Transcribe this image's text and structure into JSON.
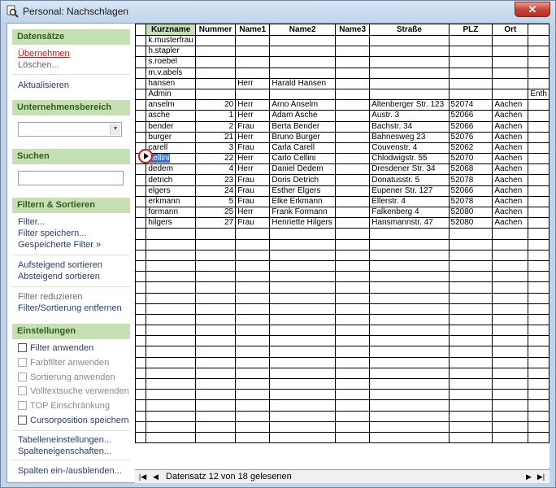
{
  "window": {
    "title": "Personal: Nachschlagen",
    "close_icon": "close-icon"
  },
  "sidebar": {
    "datensaetze": {
      "header": "Datensätze",
      "uebernehmen": "Übernehmen",
      "loeschen": "Löschen...",
      "aktualisieren": "Aktualisieren"
    },
    "unternehmensbereich": {
      "header": "Unternehmensbereich",
      "value": ""
    },
    "suchen": {
      "header": "Suchen",
      "value": ""
    },
    "filtern": {
      "header": "Filtern & Sortieren",
      "filter": "Filter...",
      "filter_speichern": "Filter speichern...",
      "gespeicherte_filter": "Gespeicherte Filter »",
      "aufsteigend": "Aufsteigend sortieren",
      "absteigend": "Absteigend sortieren",
      "reduzieren": "Filter reduzieren",
      "entfernen": "Filter/Sortierung entfernen"
    },
    "einstellungen": {
      "header": "Einstellungen",
      "filter_anwenden": "Filter anwenden",
      "farbfilter": "Farbfilter anwenden",
      "sortierung": "Sortierung anwenden",
      "volltextsuche": "Volltextsuche verwenden",
      "top": "TOP Einschränkung",
      "cursorposition": "Cursorposition speichern",
      "tabelleneinstellungen": "Tabelleneinstellungen...",
      "spalteneigenschaften": "Spalteneigenschaften...",
      "spalten_einaus": "Spalten ein-/ausblenden..."
    }
  },
  "table": {
    "columns": [
      "Kurzname",
      "Nummer",
      "Name1",
      "Name2",
      "Name3",
      "Straße",
      "PLZ",
      "Ort",
      ""
    ],
    "rows": [
      [
        "k.musterfrau",
        "",
        "",
        "",
        "",
        "",
        "",
        "",
        ""
      ],
      [
        "h.stapler",
        "",
        "",
        "",
        "",
        "",
        "",
        "",
        ""
      ],
      [
        "s.roebel",
        "",
        "",
        "",
        "",
        "",
        "",
        "",
        ""
      ],
      [
        "m.v.abels",
        "",
        "",
        "",
        "",
        "",
        "",
        "",
        ""
      ],
      [
        "hansen",
        "",
        "Herr",
        "Harald Hansen",
        "",
        "",
        "",
        "",
        ""
      ],
      [
        "Admin",
        "",
        "",
        "",
        "",
        "",
        "",
        "",
        "Enth"
      ],
      [
        "anselm",
        "20",
        "Herr",
        "Arno Anselm",
        "",
        "Altenberger Str. 123",
        "52074",
        "Aachen",
        ""
      ],
      [
        "asche",
        "1",
        "Herr",
        "Adam Asche",
        "",
        "Austr. 3",
        "52066",
        "Aachen",
        ""
      ],
      [
        "bender",
        "2",
        "Frau",
        "Berta Bender",
        "",
        "Bachstr. 34",
        "52066",
        "Aachen",
        ""
      ],
      [
        "burger",
        "21",
        "Herr",
        "Bruno Burger",
        "",
        "Bahnesweg 23",
        "52076",
        "Aachen",
        ""
      ],
      [
        "carell",
        "3",
        "Frau",
        "Carla Carell",
        "",
        "Couvenstr. 4",
        "52062",
        "Aachen",
        ""
      ],
      [
        "cellini",
        "22",
        "Herr",
        "Carlo Cellini",
        "",
        "Chlodwigstr. 55",
        "52070",
        "Aachen",
        ""
      ],
      [
        "dedem",
        "4",
        "Herr",
        "Daniel Dedem",
        "",
        "Dresdener Str. 34",
        "52068",
        "Aachen",
        ""
      ],
      [
        "detrich",
        "23",
        "Frau",
        "Doris Detrich",
        "",
        "Donatusstr. 5",
        "52078",
        "Aachen",
        ""
      ],
      [
        "elgers",
        "24",
        "Frau",
        "Esther Elgers",
        "",
        "Eupener Str. 127",
        "52066",
        "Aachen",
        ""
      ],
      [
        "erkmann",
        "5",
        "Frau",
        "Elke Erkmann",
        "",
        "Ellerstr. 4",
        "52078",
        "Aachen",
        ""
      ],
      [
        "formann",
        "25",
        "Herr",
        "Frank Formann",
        "",
        "Falkenberg 4",
        "52080",
        "Aachen",
        ""
      ],
      [
        "hilgers",
        "27",
        "Frau",
        "Henriette Hilgers",
        "",
        "Hansmannstr. 47",
        "52080",
        "Aachen",
        ""
      ]
    ],
    "selected_index": 11
  },
  "navbar": {
    "status": "Datensatz 12 von 18 gelesenen"
  }
}
